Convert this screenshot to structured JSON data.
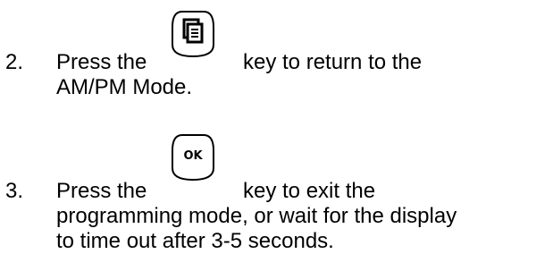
{
  "steps": [
    {
      "number": "2.",
      "before_key": "Press the",
      "after_key": "key to return to the",
      "continuation": [
        "AM/PM Mode."
      ],
      "key_icon": "documents-icon"
    },
    {
      "number": "3.",
      "before_key": "Press the",
      "after_key": "key to exit the",
      "continuation": [
        "programming mode, or wait for the display",
        "to time out after 3-5 seconds."
      ],
      "key_icon": "ok-key-icon",
      "key_label": "OK"
    }
  ],
  "colors": {
    "text": "#000000",
    "background": "#ffffff"
  }
}
